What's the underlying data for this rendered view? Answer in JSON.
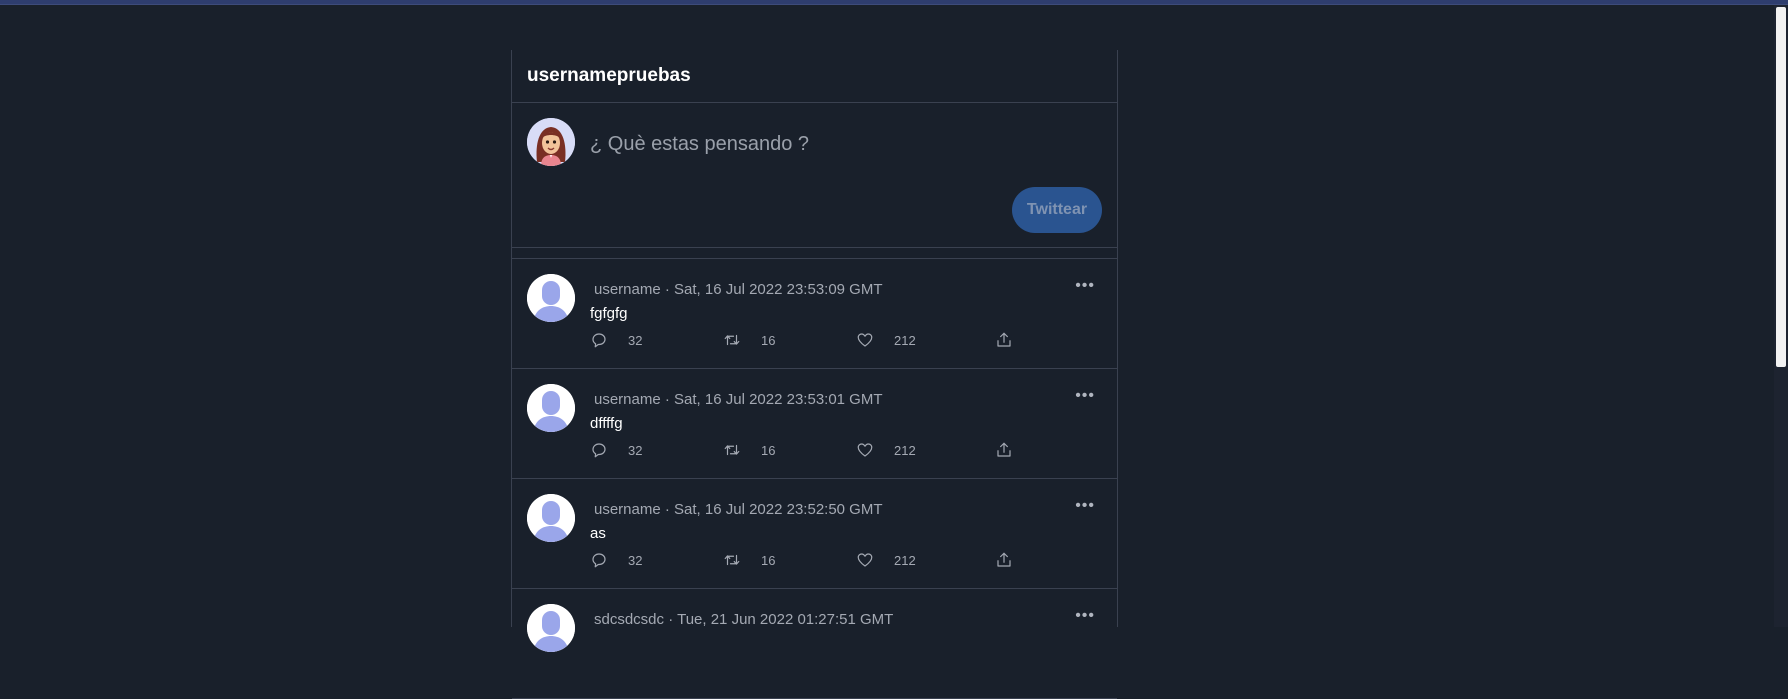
{
  "header": {
    "title": "usernamepruebas"
  },
  "compose": {
    "placeholder": "¿ Què estas pensando ?",
    "button_label": "Twittear"
  },
  "tweets": [
    {
      "username": "username",
      "date": "Sat, 16 Jul 2022 23:53:09 GMT",
      "text": "fgfgfg",
      "replies": "32",
      "retweets": "16",
      "likes": "212",
      "more": "•••"
    },
    {
      "username": "username",
      "date": "Sat, 16 Jul 2022 23:53:01 GMT",
      "text": "dffffg",
      "replies": "32",
      "retweets": "16",
      "likes": "212",
      "more": "•••"
    },
    {
      "username": "username",
      "date": "Sat, 16 Jul 2022 23:52:50 GMT",
      "text": "as",
      "replies": "32",
      "retweets": "16",
      "likes": "212",
      "more": "•••"
    },
    {
      "username": "sdcsdcsdc",
      "date": "Tue, 21 Jun 2022 01:27:51 GMT",
      "text": "",
      "replies": "",
      "retweets": "",
      "likes": "",
      "more": "•••"
    }
  ],
  "icons": {
    "reply": "reply-icon",
    "retweet": "retweet-icon",
    "like": "heart-icon",
    "share": "share-icon",
    "more": "more-icon"
  },
  "colors": {
    "background": "#19202b",
    "accent_button": "#2a5490",
    "border": "#3a4150"
  }
}
